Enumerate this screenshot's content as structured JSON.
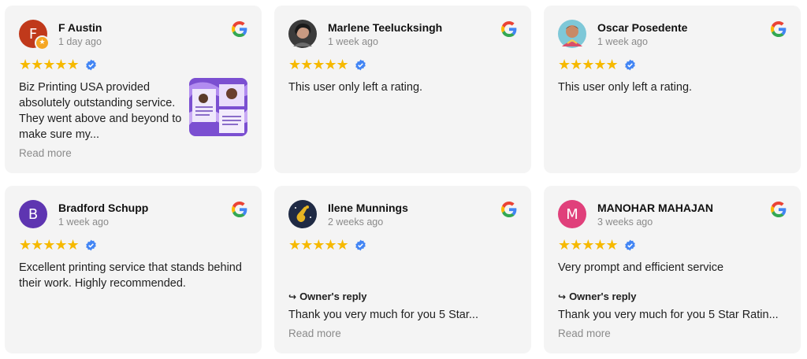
{
  "reviews": [
    {
      "name": "F Austin",
      "time": "1 day ago",
      "avatar_letter": "F",
      "avatar_color": "#c0391b",
      "has_badge": true,
      "stars": "★★★★★",
      "text": "Biz Printing USA provided absolutely outstanding service. They went above and beyond to make sure my...",
      "read_more": "Read more"
    },
    {
      "name": "Marlene Teelucksingh",
      "time": "1 week ago",
      "stars": "★★★★★",
      "text": "This user only left a rating."
    },
    {
      "name": "Oscar Posedente",
      "time": "1 week ago",
      "stars": "★★★★★",
      "text": "This user only left a rating."
    },
    {
      "name": "Bradford Schupp",
      "time": "1 week ago",
      "avatar_letter": "B",
      "avatar_color": "#5e35b1",
      "stars": "★★★★★",
      "text": "Excellent printing service that stands behind their work. Highly recommended."
    },
    {
      "name": "Ilene Munnings",
      "time": "2 weeks ago",
      "stars": "★★★★★",
      "text": "",
      "reply_title": "Owner's reply",
      "reply_text": "Thank you very much for you 5 Star...",
      "read_more": "Read more"
    },
    {
      "name": "MANOHAR MAHAJAN",
      "time": "3 weeks ago",
      "avatar_letter": "M",
      "avatar_color": "#e0407b",
      "stars": "★★★★★",
      "text": "Very prompt and efficient service",
      "reply_title": "Owner's reply",
      "reply_text": "Thank you very much for you 5 Star Ratin...",
      "read_more": "Read more"
    }
  ],
  "colors": {
    "star": "#f6b900",
    "verified": "#4285f4",
    "card_bg": "#f4f4f4"
  },
  "icons": {
    "google": "google-g-icon",
    "verified": "verified-check-icon"
  }
}
